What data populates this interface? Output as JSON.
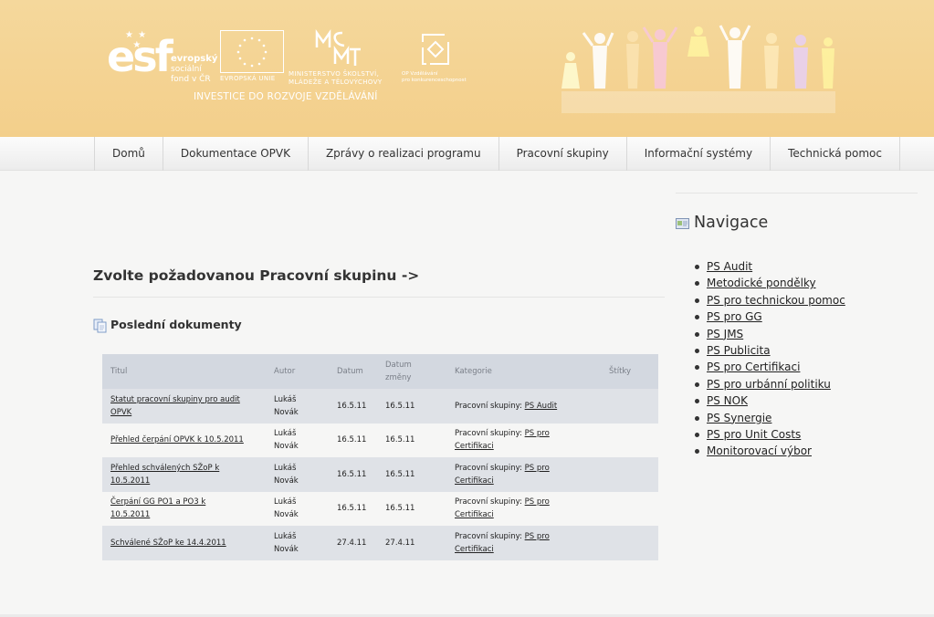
{
  "header": {
    "esf_lines": [
      "evropský",
      "sociální",
      "fond v ČR"
    ],
    "esf_mark": "esf",
    "eu_label": "EVROPSKÁ UNIE",
    "msmt_label_1": "MINISTERSTVO ŠKOLSTVÍ,",
    "msmt_label_2": "MLÁDEŽE A TĚLOVÝCHOVY",
    "op_label_1": "OP Vzdělávání",
    "op_label_2": "pro konkurenceschopnost",
    "tagline": "INVESTICE DO ROZVOJE VZDĚLÁVÁNÍ"
  },
  "nav": {
    "items": [
      "Domů",
      "Dokumentace OPVK",
      "Zprávy o realizaci programu",
      "Pracovní skupiny",
      "Informační systémy",
      "Technická pomoc"
    ]
  },
  "main": {
    "heading": "Zvolte požadovanou Pracovní skupinu ->",
    "docs_title": "Poslední dokumenty",
    "columns": {
      "titul": "Titul",
      "autor": "Autor",
      "datum": "Datum",
      "datum_zmeny_1": "Datum",
      "datum_zmeny_2": "změny",
      "kategorie": "Kategorie",
      "stitky": "Štítky"
    },
    "rows": [
      {
        "title_1": "Statut pracovní skupiny pro audit",
        "title_2": "OPVK",
        "author_1": "Lukáš",
        "author_2": "Novák",
        "date": "16.5.11",
        "changed": "16.5.11",
        "cat_prefix": "Pracovní skupiny: ",
        "cat_link_1": "PS Audit",
        "cat_link_2": ""
      },
      {
        "title_1": "Přehled čerpání OPVK k 10.5.2011",
        "title_2": "",
        "author_1": "Lukáš",
        "author_2": "Novák",
        "date": "16.5.11",
        "changed": "16.5.11",
        "cat_prefix": "Pracovní skupiny: ",
        "cat_link_1": "PS pro",
        "cat_link_2": "Certifikaci"
      },
      {
        "title_1": "Přehled schválených SŽoP k",
        "title_2": "10.5.2011",
        "author_1": "Lukáš",
        "author_2": "Novák",
        "date": "16.5.11",
        "changed": "16.5.11",
        "cat_prefix": "Pracovní skupiny: ",
        "cat_link_1": "PS pro",
        "cat_link_2": "Certifikaci"
      },
      {
        "title_1": "Čerpání GG PO1 a PO3 k",
        "title_2": "10.5.2011",
        "author_1": "Lukáš",
        "author_2": "Novák",
        "date": "16.5.11",
        "changed": "16.5.11",
        "cat_prefix": "Pracovní skupiny: ",
        "cat_link_1": "PS pro",
        "cat_link_2": "Certifikaci"
      },
      {
        "title_1": "Schválené SŽoP ke 14.4.2011",
        "title_2": "",
        "author_1": "Lukáš",
        "author_2": "Novák",
        "date": "27.4.11",
        "changed": "27.4.11",
        "cat_prefix": "Pracovní skupiny: ",
        "cat_link_1": "PS pro",
        "cat_link_2": "Certifikaci"
      }
    ]
  },
  "sidebar": {
    "title": "Navigace",
    "links": [
      "PS Audit",
      "Metodické pondělky",
      "PS pro technickou pomoc",
      "PS pro GG",
      "PS JMS",
      "PS Publicita",
      "PS pro Certifikaci",
      "PS pro urbánní politiku",
      "PS NOK",
      "PS Synergie",
      "PS pro Unit Costs",
      "Monitorovací výbor"
    ]
  },
  "colors": {
    "header_bg": "#f3cf8b",
    "table_header": "#d3d8e0",
    "table_odd": "#dfe2e7",
    "page_bg": "#f6f6f5"
  }
}
